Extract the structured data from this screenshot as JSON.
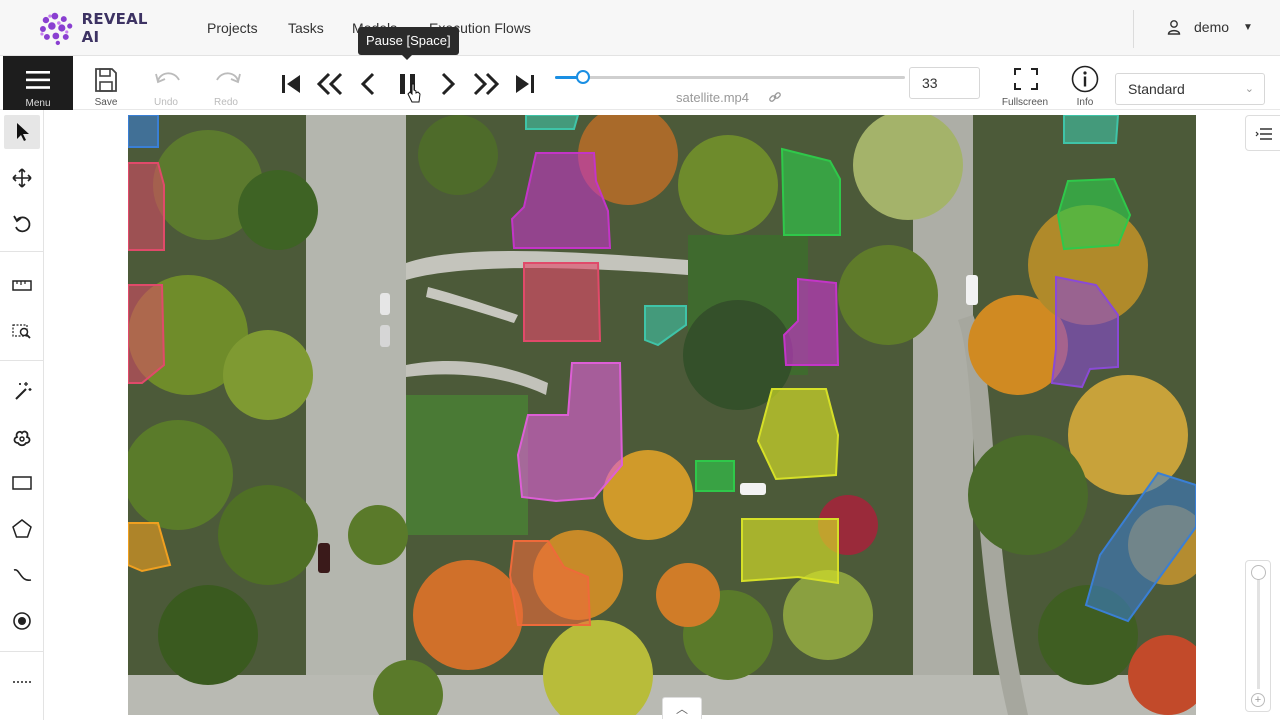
{
  "app": {
    "brand": "REVEAL AI"
  },
  "nav": {
    "items": [
      {
        "label": "Projects"
      },
      {
        "label": "Tasks"
      },
      {
        "label": "Models"
      },
      {
        "label": "Execution Flows"
      }
    ],
    "user": {
      "name": "demo",
      "icon": "user-icon"
    }
  },
  "toolbar": {
    "menu_label": "Menu",
    "save_label": "Save",
    "undo_label": "Undo",
    "redo_label": "Redo",
    "tooltip": "Pause [Space]",
    "playback": [
      "first-frame-icon",
      "rewind-icon",
      "prev-frame-icon",
      "pause-icon",
      "next-frame-icon",
      "fast-forward-icon",
      "last-frame-icon"
    ],
    "progress": 0.08,
    "filename": "satellite.mp4",
    "frame_value": "33",
    "fullscreen_label": "Fullscreen",
    "info_label": "Info",
    "preset": "Standard",
    "accent": "#1a8fe3"
  },
  "sidebar": {
    "tools": [
      "select-icon",
      "move-icon",
      "rotate-icon",
      "ruler-icon",
      "zoom-region-icon",
      "magic-wand-icon",
      "blob-icon",
      "rectangle-icon",
      "polygon-icon",
      "curve-icon",
      "point-icon",
      "more-icon"
    ]
  },
  "annotations": {
    "colors": {
      "blue": "#3a7fd5",
      "red": "#e04a6a",
      "magenta": "#c335c7",
      "pink": "#dd5fd6",
      "teal": "#3fc4a8",
      "green": "#2fc84a",
      "purple": "#8a4ad6",
      "yellow": "#d6e028",
      "orange": "#ee6a3a",
      "gold": "#f0a020"
    }
  }
}
